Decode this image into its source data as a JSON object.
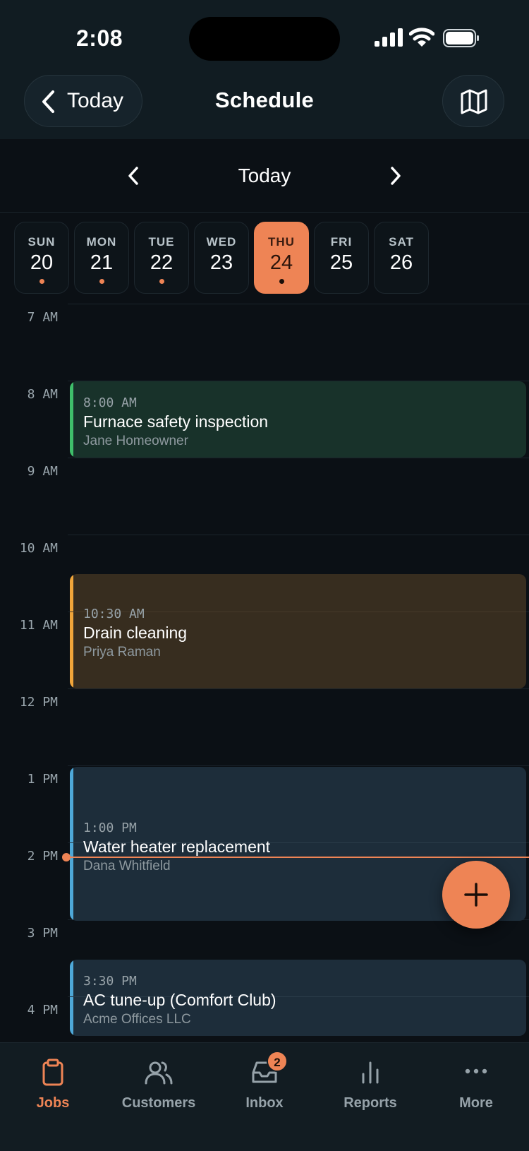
{
  "status_bar": {
    "time": "2:08"
  },
  "header": {
    "back_label": "Today",
    "title": "Schedule"
  },
  "date_nav": {
    "label": "Today"
  },
  "days": [
    {
      "dow": "SUN",
      "num": "20",
      "has_jobs": true,
      "selected": false
    },
    {
      "dow": "MON",
      "num": "21",
      "has_jobs": true,
      "selected": false
    },
    {
      "dow": "TUE",
      "num": "22",
      "has_jobs": true,
      "selected": false
    },
    {
      "dow": "WED",
      "num": "23",
      "has_jobs": false,
      "selected": false
    },
    {
      "dow": "THU",
      "num": "24",
      "has_jobs": true,
      "selected": true
    },
    {
      "dow": "FRI",
      "num": "25",
      "has_jobs": false,
      "selected": false
    },
    {
      "dow": "SAT",
      "num": "26",
      "has_jobs": false,
      "selected": false
    }
  ],
  "hours": [
    "7 AM",
    "8 AM",
    "9 AM",
    "10 AM",
    "11 AM",
    "12 PM",
    "1 PM",
    "2 PM",
    "3 PM",
    "4 PM"
  ],
  "events": [
    {
      "time": "8:00 AM",
      "title": "Furnace safety inspection",
      "customer": "Jane Homeowner",
      "accent": "#3fbf6a",
      "bg": "#18322a"
    },
    {
      "time": "10:30 AM",
      "title": "Drain cleaning",
      "customer": "Priya Raman",
      "accent": "#f0a53a",
      "bg": "#372d1f"
    },
    {
      "time": "1:00 PM",
      "title": "Water heater replacement",
      "customer": "Dana Whitfield",
      "accent": "#4ea8d8",
      "bg": "#1d2d3a"
    },
    {
      "time": "3:30 PM",
      "title": "AC tune-up (Comfort Club)",
      "customer": "Acme Offices LLC",
      "accent": "#4ea8d8",
      "bg": "#1d2d3a"
    }
  ],
  "colors": {
    "accent": "#ee8455",
    "background": "#0b1015",
    "header": "#111c22"
  },
  "tabs": [
    {
      "label": "Jobs",
      "icon": "clipboard-icon",
      "active": true
    },
    {
      "label": "Customers",
      "icon": "users-icon",
      "active": false
    },
    {
      "label": "Inbox",
      "icon": "inbox-icon",
      "active": false,
      "badge": "2"
    },
    {
      "label": "Reports",
      "icon": "bar-chart-icon",
      "active": false
    },
    {
      "label": "More",
      "icon": "more-icon",
      "active": false
    }
  ]
}
